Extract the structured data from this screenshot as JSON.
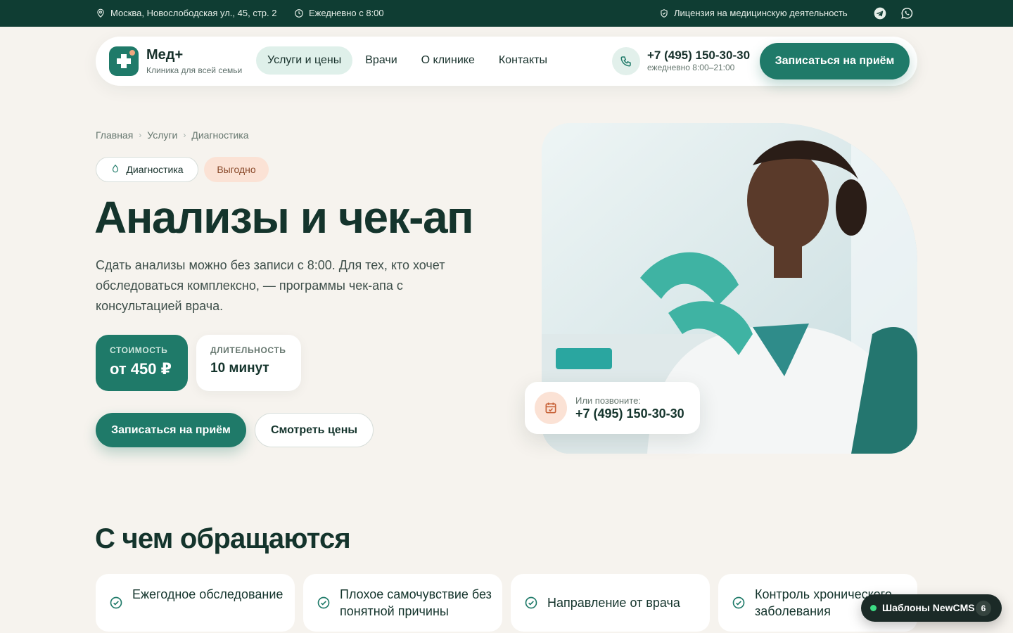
{
  "topbar": {
    "address": "Москва, Новослободская ул., 45, стр. 2",
    "hours": "Ежедневно с 8:00",
    "license": "Лицензия на медицинскую деятельность"
  },
  "header": {
    "logo_name": "Мед+",
    "logo_subtitle": "Клиника для всей семьи",
    "nav": [
      "Услуги и цены",
      "Врачи",
      "О клинике",
      "Контакты"
    ],
    "phone": "+7 (495) 150-30-30",
    "phone_hours": "ежедневно 8:00–21:00",
    "cta": "Записаться на приём"
  },
  "breadcrumb": [
    "Главная",
    "Услуги",
    "Диагностика"
  ],
  "tags": {
    "category": "Диагностика",
    "promo": "Выгодно"
  },
  "hero": {
    "title": "Анализы и чек-ап",
    "description": "Сдать анализы можно без записи с 8:00. Для тех, кто хочет обследоваться комплексно, — программы чек-апа с консультацией врача.",
    "price_label": "СТОИМОСТЬ",
    "price_value": "от 450 ₽",
    "duration_label": "ДЛИТЕЛЬНОСТЬ",
    "duration_value": "10 минут",
    "cta_primary": "Записаться на приём",
    "cta_secondary": "Смотреть цены"
  },
  "call_card": {
    "label": "Или позвоните:",
    "phone": "+7 (495) 150-30-30"
  },
  "reasons": {
    "title": "С чем обращаются",
    "items": [
      "Ежегодное обследование",
      "Плохое самочувствие без понятной причины",
      "Направление от врача",
      "Контроль хронического заболевания"
    ]
  },
  "badge": {
    "label": "Шаблоны NewCMS",
    "count": "6"
  },
  "colors": {
    "brand": "#1f7a69",
    "dark": "#0f3d33",
    "background": "#f6f3ee",
    "accent_peach": "#fbe2d5"
  },
  "icons": [
    "pin-icon",
    "clock-icon",
    "shield-icon",
    "telegram-icon",
    "whatsapp-icon",
    "phone-icon",
    "drop-icon",
    "calendar-icon",
    "check-icon"
  ]
}
